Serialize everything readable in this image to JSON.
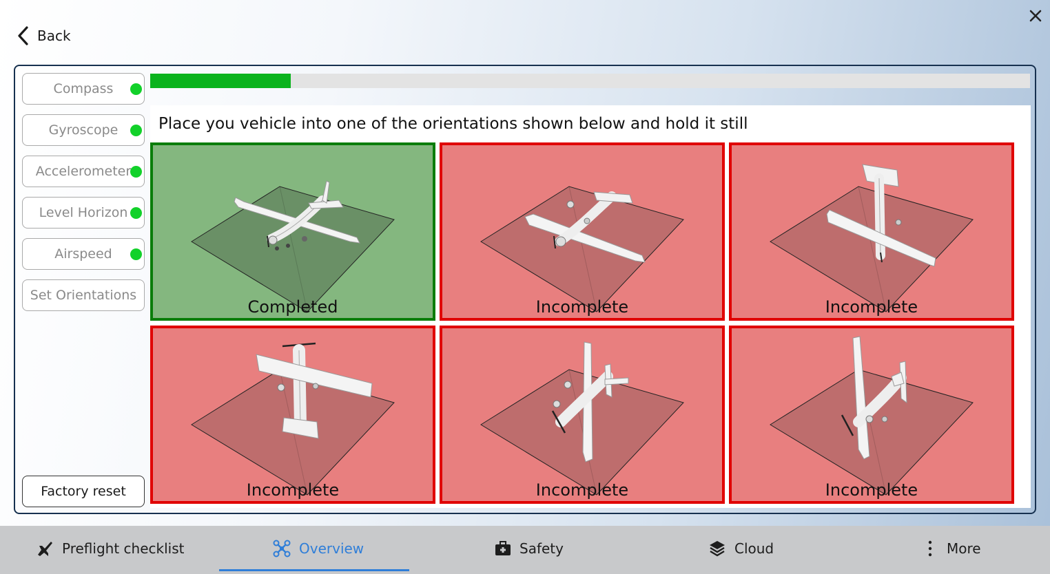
{
  "header": {
    "back_label": "Back",
    "back_icon": "chevron-left-icon",
    "close_icon": "close-icon"
  },
  "sidebar": {
    "items": [
      {
        "label": "Compass",
        "status": "ok"
      },
      {
        "label": "Gyroscope",
        "status": "ok"
      },
      {
        "label": "Accelerometer",
        "status": "ok"
      },
      {
        "label": "Level Horizon",
        "status": "ok"
      },
      {
        "label": "Airspeed",
        "status": "ok"
      },
      {
        "label": "Set Orientations",
        "status": "none"
      }
    ],
    "factory_reset_label": "Factory reset",
    "status_color": "#12d12a"
  },
  "calibration": {
    "progress": 0.16,
    "progress_color": "#0bb31d",
    "instruction": "Place you vehicle into one of the orientations shown below and hold it still",
    "orientations": [
      {
        "status": "Completed",
        "state": "complete"
      },
      {
        "status": "Incomplete",
        "state": "incomplete"
      },
      {
        "status": "Incomplete",
        "state": "incomplete"
      },
      {
        "status": "Incomplete",
        "state": "incomplete"
      },
      {
        "status": "Incomplete",
        "state": "incomplete"
      },
      {
        "status": "Incomplete",
        "state": "incomplete"
      }
    ],
    "colors": {
      "complete_fill": "#84b77f",
      "complete_border": "#0a7d0a",
      "incomplete_fill": "#e87f7f",
      "incomplete_border": "#e00000"
    }
  },
  "bottom_nav": {
    "items": [
      {
        "label": "Preflight checklist",
        "icon": "checklist-plane-icon",
        "active": false
      },
      {
        "label": "Overview",
        "icon": "drone-icon",
        "active": true
      },
      {
        "label": "Safety",
        "icon": "first-aid-kit-icon",
        "active": false
      },
      {
        "label": "Cloud",
        "icon": "layers-icon",
        "active": false
      },
      {
        "label": "More",
        "icon": "more-vertical-icon",
        "active": false
      }
    ],
    "active_color": "#2f7ed8"
  }
}
